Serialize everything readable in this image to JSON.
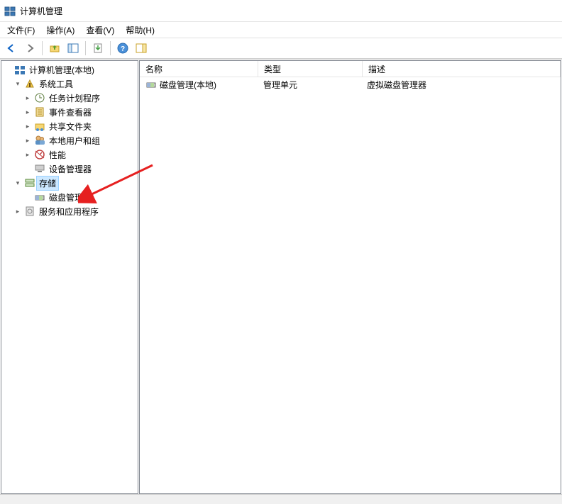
{
  "title": "计算机管理",
  "menu": {
    "file": "文件(F)",
    "action": "操作(A)",
    "view": "查看(V)",
    "help": "帮助(H)"
  },
  "tree": {
    "root": "计算机管理(本地)",
    "system_tools": "系统工具",
    "task_scheduler": "任务计划程序",
    "event_viewer": "事件查看器",
    "shared_folders": "共享文件夹",
    "local_users": "本地用户和组",
    "performance": "性能",
    "device_manager": "设备管理器",
    "storage": "存储",
    "disk_management": "磁盘管理",
    "services_apps": "服务和应用程序"
  },
  "list": {
    "col_name": "名称",
    "col_type": "类型",
    "col_desc": "描述",
    "rows": [
      {
        "name": "磁盘管理(本地)",
        "type": "管理单元",
        "desc": "虚拟磁盘管理器"
      }
    ]
  }
}
